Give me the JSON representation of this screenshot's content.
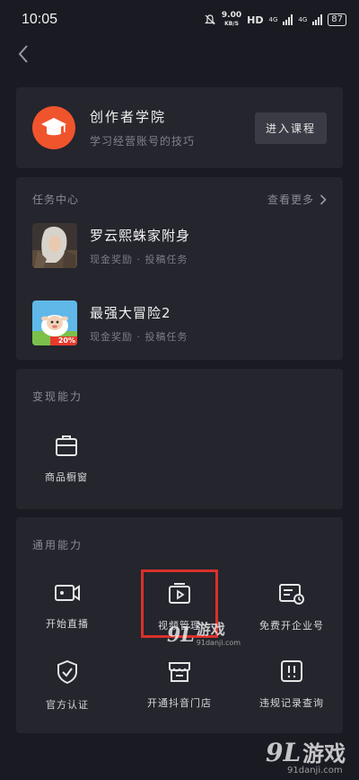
{
  "status": {
    "time": "10:05",
    "speed_value": "9.00",
    "speed_unit": "KB/S",
    "hd": "HD",
    "net1": "4G",
    "net2": "4G",
    "battery": "87"
  },
  "academy": {
    "title": "创作者学院",
    "subtitle": "学习经营账号的技巧",
    "button": "进入课程"
  },
  "tasks": {
    "title": "任务中心",
    "more": "查看更多",
    "items": [
      {
        "title": "罗云熙蛛家附身",
        "subtitle": "现金奖励 · 投稿任务"
      },
      {
        "title": "最强大冒险2",
        "subtitle": "现金奖励 · 投稿任务",
        "badge": "20%"
      }
    ]
  },
  "ability_video": {
    "title": "变现能力",
    "items": [
      {
        "label": "商品橱窗",
        "icon": "shopping-bag-icon"
      }
    ]
  },
  "ability_general": {
    "title": "通用能力",
    "items": [
      {
        "label": "开始直播",
        "icon": "live-camera-icon"
      },
      {
        "label": "视频管理",
        "icon": "video-play-icon"
      },
      {
        "label": "免费开企业号",
        "icon": "enterprise-badge-icon"
      },
      {
        "label": "官方认证",
        "icon": "shield-check-icon"
      },
      {
        "label": "开通抖音门店",
        "icon": "store-icon"
      },
      {
        "label": "违规记录查询",
        "icon": "violation-alert-icon"
      }
    ]
  },
  "watermark": {
    "logo": "9L",
    "text": "游戏",
    "url": "91danji.com"
  },
  "colors": {
    "background": "#1a1b22",
    "card": "#24252d",
    "accent": "#f0542d",
    "highlight": "#d9302b"
  }
}
